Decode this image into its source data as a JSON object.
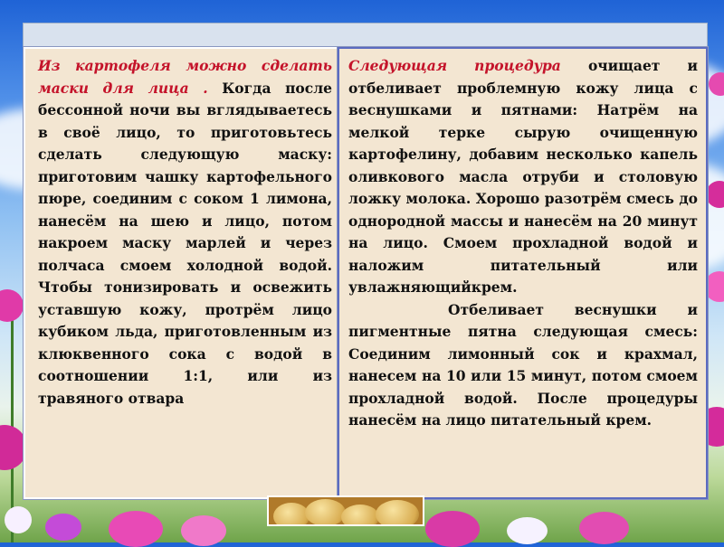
{
  "left": {
    "red_text": "Из картофеля можно сделать маски для лица .",
    "body_text": " Когда после бессонной ночи вы вглядываетесь в своё лицо, то приготовьтесь сделать следующую маску: приготовим чашку картофельного пюре, соединим с соком 1 лимона, нанесём на шею и лицо, потом накроем маску марлей и через полчаса смоем холодной водой. Чтобы тонизировать и освежить уставшую кожу, протрём лицо кубиком льда, приготовленным из клюквенного сока с водой в соотношении 1:1, или из травяного отвара"
  },
  "right": {
    "red_text": "Следующая процедура",
    "body_text": " очищает и отбеливает проблемную кожу лица с веснушками и пятнами: Натрём на мелкой терке сырую очищенную картофелину, добавим несколько капель оливкового масла отруби и столовую ложку молока. Хорошо разотрём смесь до однородной массы и нанесём на 20 минут на лицо. Смоем прохладной водой и наложим питательный или увлажняющийкрем.",
    "body_text_2": "Отбеливает веснушки и пигментные пятна следующая смесь: Соединим лимонный сок и крахмал, нанесем на 10 или 15 минут, потом смоем прохладной водой. После процедуры нанесём на лицо питательный крем."
  },
  "colors": {
    "panel_bg": "#f3e6d2",
    "red_accent": "#c4132a",
    "right_border": "#5b6bc0"
  }
}
